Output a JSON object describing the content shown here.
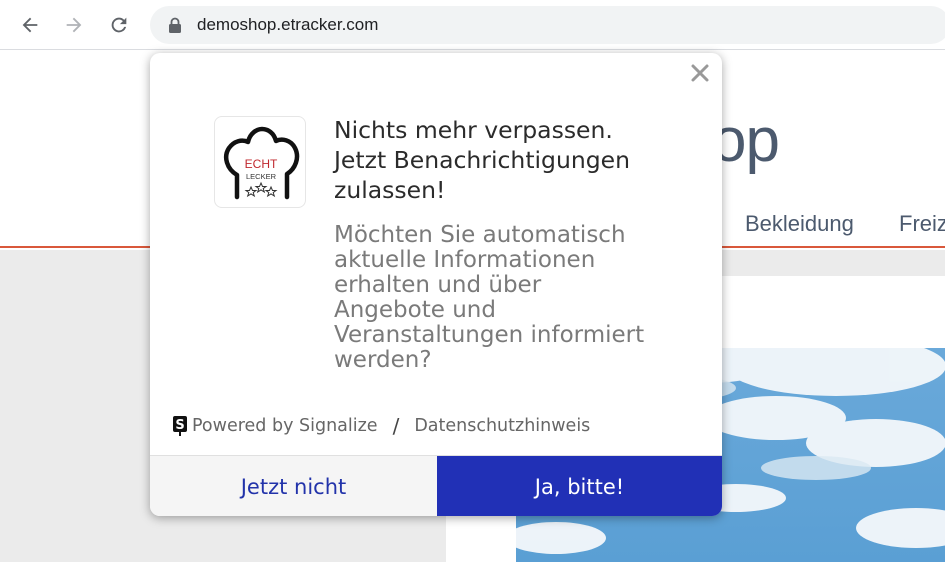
{
  "browser": {
    "url": "demoshop.etracker.com",
    "icons": [
      "back-arrow-icon",
      "forward-arrow-icon",
      "reload-icon",
      "lock-icon"
    ]
  },
  "page": {
    "logo_fragment": "op",
    "menu": [
      "Bekleidung",
      "Freiz"
    ]
  },
  "modal": {
    "title_lines": [
      "Nichts mehr verpassen.",
      "Jetzt Benachrichtigungen",
      "zulassen!"
    ],
    "message_lines": [
      "Möchten Sie automatisch",
      "aktuelle Informationen",
      "erhalten und über",
      "Angebote und",
      "Veranstaltungen informiert",
      "werden?"
    ],
    "app_logo": {
      "top_text": "ECHT",
      "bottom_text": "LECKER"
    },
    "footer": {
      "powered_by": "Powered by Signalize",
      "separator": "/",
      "privacy_link": "Datenschutzhinweis"
    },
    "buttons": {
      "decline": "Jetzt nicht",
      "accept": "Ja, bitte!"
    }
  },
  "colors": {
    "accent_blue": "#2130b6",
    "header_line": "#d9583b",
    "logo_text": "#4c5a6e"
  }
}
